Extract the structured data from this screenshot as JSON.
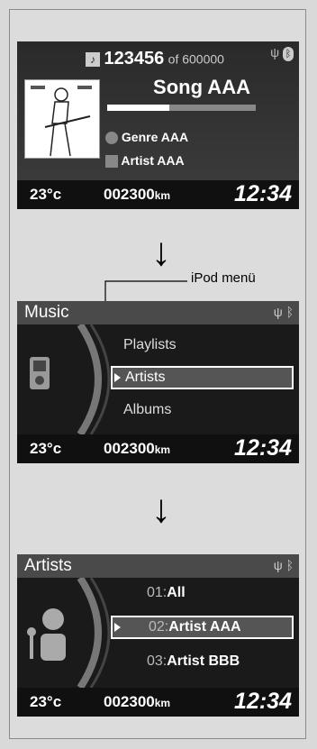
{
  "screen1": {
    "track_number": "123456",
    "track_total": "of 600000",
    "song": "Song AAA",
    "genre": "Genre AAA",
    "artist": "Artist AAA",
    "progress": 0.42
  },
  "bottom_bar": {
    "temp": "23°c",
    "odometer": "002300",
    "odometer_unit": "km",
    "clock": "12:34"
  },
  "callout_label": "iPod menü",
  "screen2": {
    "title": "Music",
    "items": [
      "Playlists",
      "Artists",
      "Albums"
    ],
    "selected_index": 1
  },
  "screen3": {
    "title": "Artists",
    "items": [
      {
        "num": "01:",
        "label": "All"
      },
      {
        "num": "02:",
        "label": "Artist AAA"
      },
      {
        "num": "03:",
        "label": "Artist BBB"
      }
    ],
    "selected_index": 1
  }
}
